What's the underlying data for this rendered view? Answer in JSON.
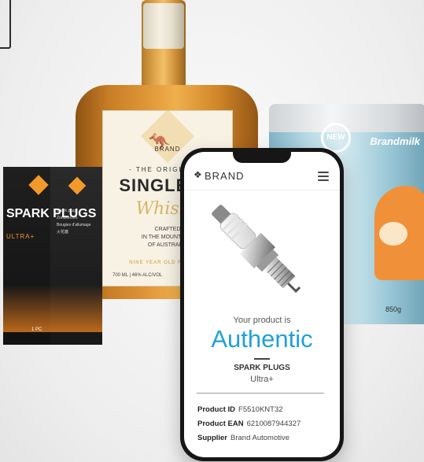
{
  "whisky": {
    "brand": "BRAND",
    "original": "- THE ORIGINAL -",
    "title": "SINGLE MA",
    "subtitle": "Whisky",
    "crafted": "CRAFTED\nIN THE MOUNTAINS\nOF AUSTRALIA",
    "reserve": "NINE YEAR OLD RESERVE",
    "volume": "700 ML | 46% ALC/VOL"
  },
  "milk": {
    "brand": "Brandmilk",
    "badge": "NEW",
    "weight": "850g"
  },
  "sparkbox": {
    "title": "SPARK PLUGS",
    "variant": "ULTRA+",
    "side_text": "Spark plugs\nZündkerzen\nBougies d'allumage\n火花塞",
    "count": "1 PC"
  },
  "phone": {
    "logo": "BRAND",
    "kicker": "Your product is",
    "status": "Authentic",
    "product_name": "SPARK PLUGS",
    "product_variant": "Ultra+",
    "details": [
      {
        "label": "Product ID",
        "value": "F5510KNT32"
      },
      {
        "label": "Product EAN",
        "value": "6210087944327"
      },
      {
        "label": "Supplier",
        "value": "Brand Automotive"
      }
    ],
    "accent_color": "#1fa0dd"
  }
}
